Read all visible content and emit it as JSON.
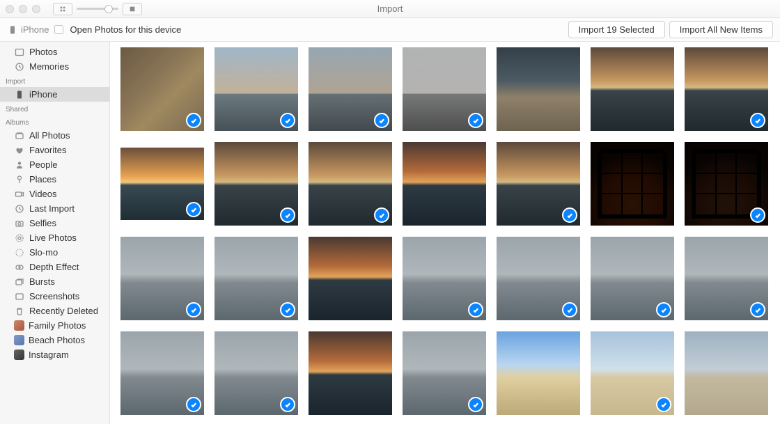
{
  "window": {
    "title": "Import"
  },
  "toolbar": {
    "device_name": "iPhone",
    "open_photos_label": "Open Photos for this device",
    "import_selected_label": "Import 19 Selected",
    "import_all_label": "Import All New Items"
  },
  "sidebar": {
    "library": [
      {
        "id": "photos",
        "label": "Photos"
      },
      {
        "id": "memories",
        "label": "Memories"
      }
    ],
    "import_header": "Import",
    "import_items": [
      {
        "id": "iphone",
        "label": "iPhone"
      }
    ],
    "shared_header": "Shared",
    "albums_header": "Albums",
    "albums": [
      {
        "id": "all-photos",
        "label": "All Photos"
      },
      {
        "id": "favorites",
        "label": "Favorites"
      },
      {
        "id": "people",
        "label": "People"
      },
      {
        "id": "places",
        "label": "Places"
      },
      {
        "id": "videos",
        "label": "Videos"
      },
      {
        "id": "last-import",
        "label": "Last Import"
      },
      {
        "id": "selfies",
        "label": "Selfies"
      },
      {
        "id": "live-photos",
        "label": "Live Photos"
      },
      {
        "id": "slomo",
        "label": "Slo-mo"
      },
      {
        "id": "depth-effect",
        "label": "Depth Effect"
      },
      {
        "id": "bursts",
        "label": "Bursts"
      },
      {
        "id": "screenshots",
        "label": "Screenshots"
      },
      {
        "id": "recently-deleted",
        "label": "Recently Deleted"
      },
      {
        "id": "family-photos",
        "label": "Family Photos"
      },
      {
        "id": "beach-photos",
        "label": "Beach Photos"
      },
      {
        "id": "instagram",
        "label": "Instagram"
      }
    ]
  },
  "grid": {
    "thumbnails": [
      {
        "style": "rock",
        "selected": true
      },
      {
        "style": "sky",
        "selected": true
      },
      {
        "style": "sky muted",
        "selected": true
      },
      {
        "style": "sky bw",
        "selected": true
      },
      {
        "style": "darkbeach",
        "selected": false
      },
      {
        "style": "sunset1 muted",
        "selected": false
      },
      {
        "style": "sunset1 muted",
        "selected": true
      },
      {
        "style": "sunset1",
        "selected": true,
        "short": true
      },
      {
        "style": "sunset1 muted",
        "selected": true
      },
      {
        "style": "sunset1 muted",
        "selected": true
      },
      {
        "style": "sunset2",
        "selected": false
      },
      {
        "style": "sunset1 muted",
        "selected": true
      },
      {
        "style": "window",
        "selected": false
      },
      {
        "style": "window muted",
        "selected": true
      },
      {
        "style": "cloudy",
        "selected": true
      },
      {
        "style": "cloudy",
        "selected": true
      },
      {
        "style": "sunset2",
        "selected": false
      },
      {
        "style": "cloudy",
        "selected": true
      },
      {
        "style": "cloudy",
        "selected": true
      },
      {
        "style": "cloudy",
        "selected": true
      },
      {
        "style": "cloudy",
        "selected": true
      },
      {
        "style": "cloudy",
        "selected": true
      },
      {
        "style": "cloudy",
        "selected": true
      },
      {
        "style": "sunset2",
        "selected": false
      },
      {
        "style": "cloudy",
        "selected": true
      },
      {
        "style": "beachbright",
        "selected": false
      },
      {
        "style": "beachday",
        "selected": true
      },
      {
        "style": "beachday muted",
        "selected": false
      }
    ]
  }
}
